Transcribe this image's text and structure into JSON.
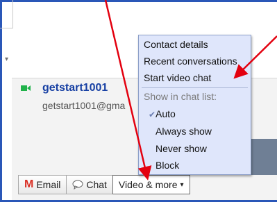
{
  "contact": {
    "name": "getstart1001",
    "email": "getstart1001@gma"
  },
  "toolbar": {
    "email_label": "Email",
    "chat_label": "Chat",
    "video_more_label": "Video & more",
    "caret": "▾"
  },
  "menu": {
    "contact_details": "Contact details",
    "recent_conversations": "Recent conversations",
    "start_video_chat": "Start video chat",
    "show_in_chat_list": "Show in chat list:",
    "options": [
      "Auto",
      "Always show",
      "Never show",
      "Block"
    ],
    "selected_option": "Auto",
    "check_mark": "✔"
  },
  "icons": {
    "video": "video-camera-icon",
    "email": "gmail-m-icon",
    "chat": "chat-bubble-icon",
    "collapse": "triangle-down-icon"
  },
  "colors": {
    "frame_border": "#2a57b8",
    "menu_bg": "#dfe6fb",
    "contact_name": "#163fa3",
    "annotation_arrow": "#e3000f",
    "video_icon": "#20b24a",
    "gmail_m": "#d93025"
  },
  "collapse_glyph": "▾"
}
